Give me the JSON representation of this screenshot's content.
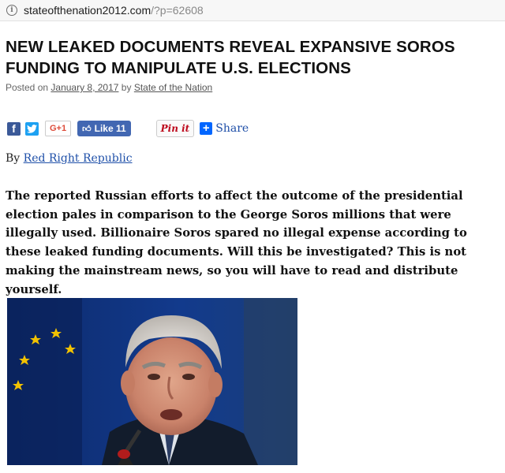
{
  "browser": {
    "url_host": "stateofthenation2012.com",
    "url_path": "/?p=62608",
    "info_icon": "info-icon"
  },
  "article": {
    "title": "NEW LEAKED DOCUMENTS REVEAL EXPANSIVE SOROS FUNDING TO MANIPULATE U.S. ELECTIONS",
    "posted_on_label": "Posted on",
    "date": "January 8, 2017",
    "by_label": "by",
    "site_author": "State of the Nation",
    "byline_prefix": "By",
    "author": "Red Right Republic",
    "lead": "The reported Russian efforts to affect the outcome of the presidential election pales in comparison to the George Soros millions that were illegally used. Billionaire Soros spared no illegal expense according to these leaked funding documents. Will this be investigated? This is not making the mainstream news, so you will have to read and distribute yourself."
  },
  "share": {
    "facebook_glyph": "f",
    "twitter_icon": "twitter-bird-icon",
    "gplus_label": "G+1",
    "like_label": "Like 11",
    "pin_label": "Pin it",
    "share_plus": "+",
    "share_label": "Share",
    "colors": {
      "facebook": "#3b5998",
      "twitter": "#1da1f2",
      "gplus": "#dd4b39",
      "like": "#4267b2",
      "pinterest": "#bd081c",
      "share": "#0166ff"
    }
  },
  "image": {
    "subject": "photo-of-elderly-man-speaking-into-microphone"
  }
}
